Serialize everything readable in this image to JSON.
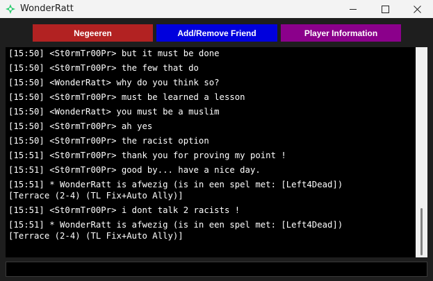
{
  "window": {
    "title": "WonderRatt"
  },
  "toolbar": {
    "ignore_label": "Negeeren",
    "friend_label": "Add/Remove Friend",
    "info_label": "Player Information",
    "colors": {
      "ignore": "#b22222",
      "friend": "#0000dd",
      "info": "#8b008b"
    }
  },
  "chat": {
    "lines": [
      "[15:50] <St0rmTr00Pr> but it must be done",
      "[15:50] <St0rmTr00Pr> the few that do",
      "[15:50] <WonderRatt> why do you think so?",
      "[15:50] <St0rmTr00Pr> must be learned a lesson",
      "[15:50] <WonderRatt> you must be a muslim",
      "[15:50] <St0rmTr00Pr> ah yes",
      "[15:50] <St0rmTr00Pr> the racist option",
      "[15:51] <St0rmTr00Pr> thank you for proving my point !",
      "[15:51] <St0rmTr00Pr> good by... have a nice day.",
      "[15:51] * WonderRatt is afwezig (is in een spel met: [Left4Dead])\n[Terrace (2-4) (TL Fix+Auto Ally)]",
      "[15:51] <St0rmTr00Pr> i dont talk 2 racists !",
      "[15:51] * WonderRatt is afwezig (is in een spel met: [Left4Dead])\n[Terrace (2-4) (TL Fix+Auto Ally)]"
    ]
  },
  "input": {
    "value": ""
  }
}
